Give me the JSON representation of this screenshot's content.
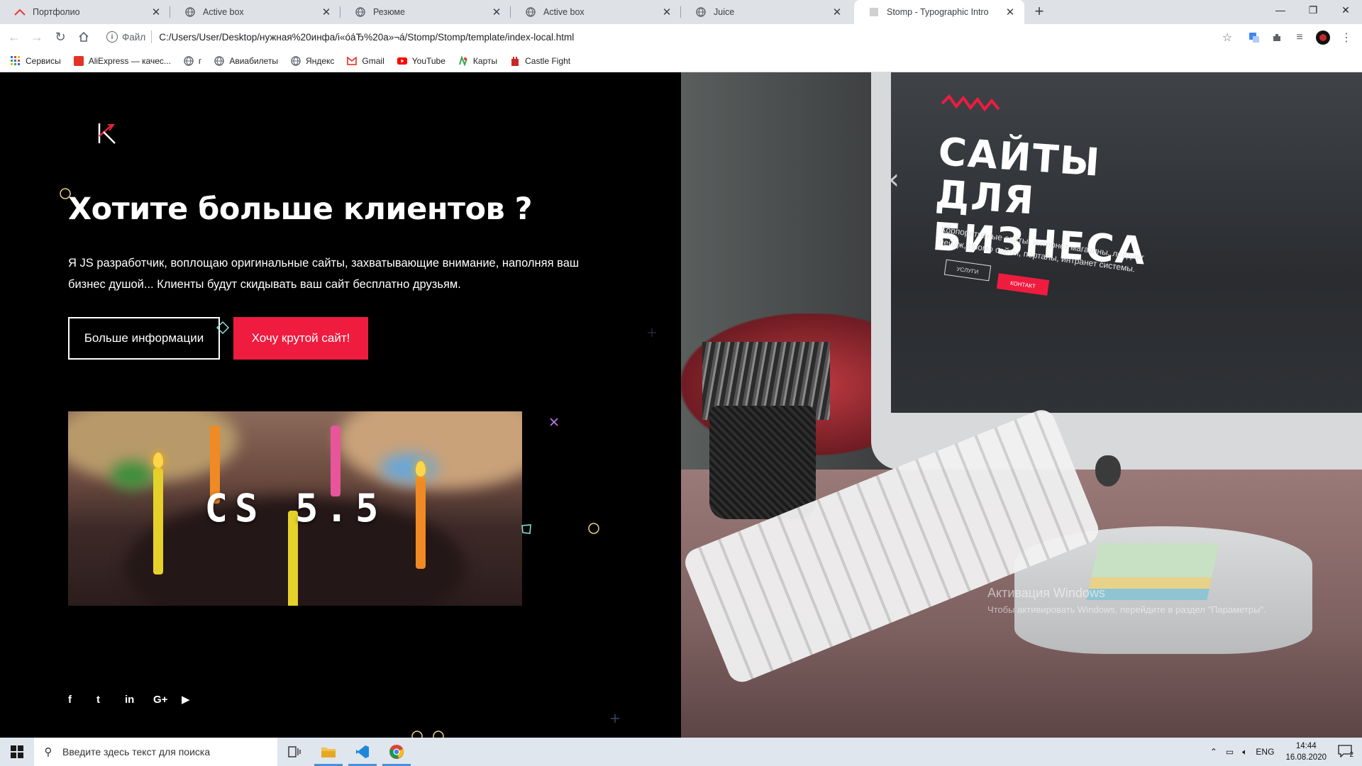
{
  "browser": {
    "tabs": [
      {
        "title": "Портфолио",
        "icon": "portfolio-icon",
        "active": false
      },
      {
        "title": "Active box",
        "icon": "globe-icon",
        "active": false
      },
      {
        "title": "Резюме",
        "icon": "globe-icon",
        "active": false
      },
      {
        "title": "Active box",
        "icon": "globe-icon",
        "active": false
      },
      {
        "title": "Juice",
        "icon": "globe-icon",
        "active": false
      },
      {
        "title": "Stomp - Typographic Intro",
        "icon": "page-icon",
        "active": true
      }
    ],
    "address": {
      "scheme_label": "Файл",
      "url": "C:/Users/User/Desktop/нужная%20инфа/і«óáЂ%20а»¬á/Stomp/Stomp/template/index-local.html"
    },
    "bookmarks": [
      {
        "label": "Сервисы",
        "icon": "apps-grid-icon"
      },
      {
        "label": "AliExpress — качес...",
        "icon": "aliexpress-icon"
      },
      {
        "label": "г",
        "icon": "globe-icon"
      },
      {
        "label": "Авиабилеты",
        "icon": "globe-icon"
      },
      {
        "label": "Яндекс",
        "icon": "globe-icon"
      },
      {
        "label": "Gmail",
        "icon": "gmail-icon"
      },
      {
        "label": "YouTube",
        "icon": "youtube-icon"
      },
      {
        "label": "Карты",
        "icon": "maps-icon"
      },
      {
        "label": "Castle Fight",
        "icon": "castle-icon"
      }
    ]
  },
  "hero": {
    "title": "Хотите больше клиентов ?",
    "text": "Я JS разработчик, воплощаю оригинальные сайты, захватывающие внимание, наполняя ваш бизнес душой... Клиенты будут скидывать ваш сайт бесплатно друзьям.",
    "btn_more": "Больше информации",
    "btn_cta": "Хочу крутой сайт!",
    "preview_caption": "CS 5.5"
  },
  "social": [
    "facebook-icon",
    "twitter-icon",
    "linkedin-icon",
    "google-plus-icon",
    "youtube-icon"
  ],
  "social_glyphs": {
    "facebook": "f",
    "twitter": "t",
    "linkedin": "in",
    "gplus": "G+",
    "youtube": "▶"
  },
  "showcase": {
    "title": "САЙТЫ ДЛЯ БИЗНЕСА",
    "subtitle": "Корпоративные сайты, интернет магазины, лейдинг пейдж, промо сайты, порталы, интранет системы.",
    "btn_services": "УСЛУГИ",
    "btn_contact": "КОНТАКТ"
  },
  "watermark": {
    "line1": "Активация Windows",
    "line2": "Чтобы активировать Windows, перейдите в раздел \"Параметры\"."
  },
  "taskbar": {
    "search_placeholder": "Введите здесь текст для поиска",
    "lang": "ENG",
    "time": "14:44",
    "date": "16.08.2020",
    "notifications": "2"
  },
  "colors": {
    "accent": "#ef1c3f",
    "page_bg": "#000000"
  }
}
